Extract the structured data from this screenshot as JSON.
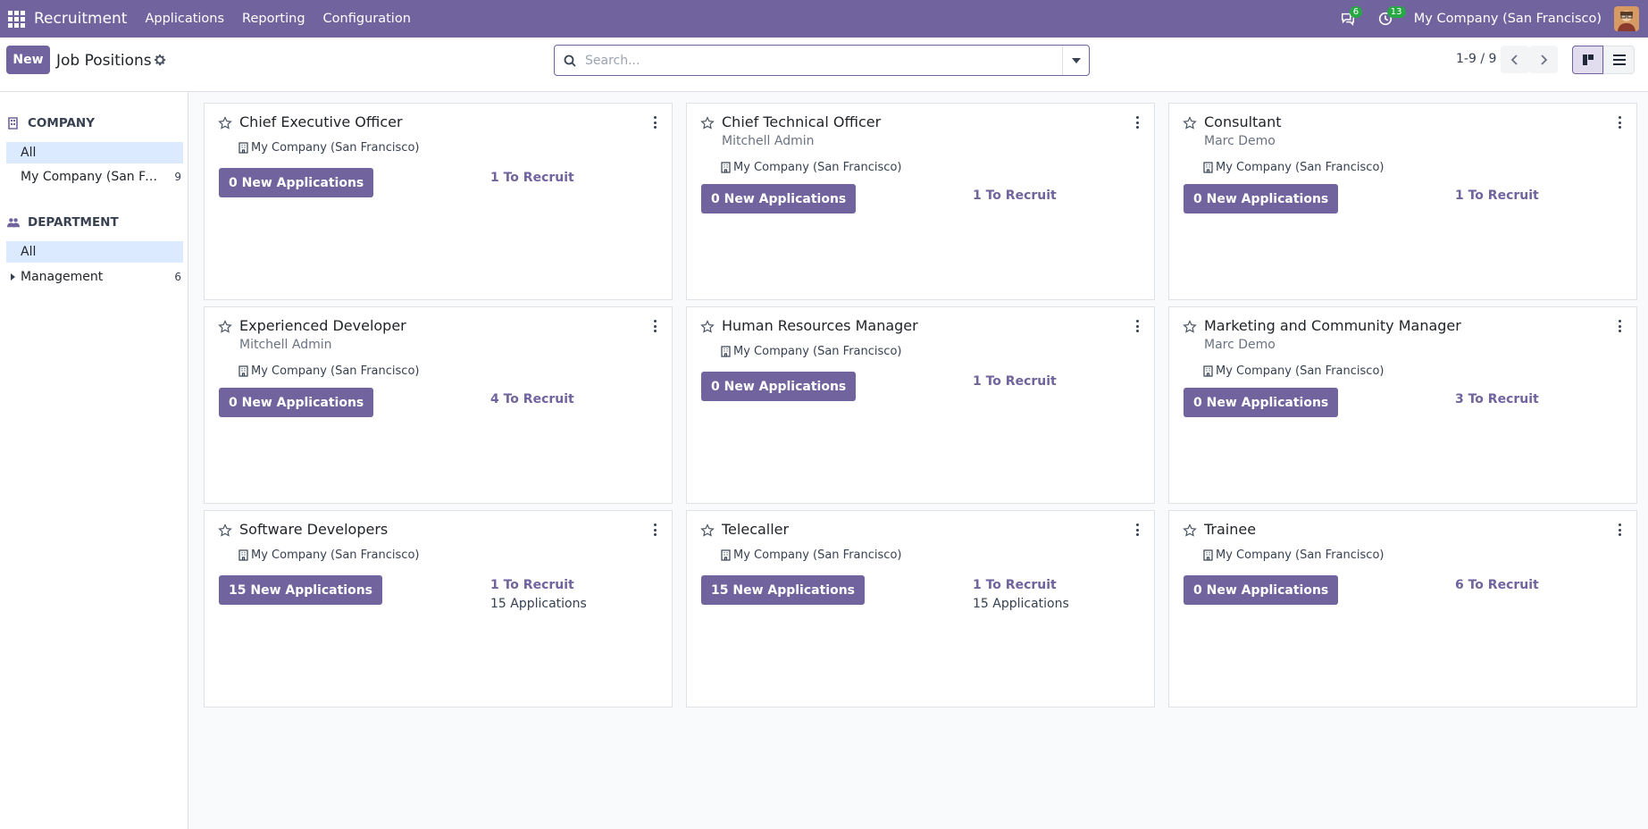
{
  "navbar": {
    "brand": "Recruitment",
    "menu": [
      "Applications",
      "Reporting",
      "Configuration"
    ],
    "messages_count": "6",
    "activities_count": "13",
    "company": "My Company (San Francisco)"
  },
  "control_panel": {
    "new_label": "New",
    "breadcrumb": "Job Positions",
    "search_placeholder": "Search...",
    "pager": "1-9 / 9"
  },
  "sidebar": {
    "company_header": "COMPANY",
    "company_items": [
      {
        "label": "All",
        "count": ""
      },
      {
        "label": "My Company (San Francisco)",
        "count": "9"
      }
    ],
    "department_header": "DEPARTMENT",
    "department_items": [
      {
        "label": "All",
        "count": ""
      },
      {
        "label": "Management",
        "count": "6"
      }
    ]
  },
  "jobs": [
    {
      "title": "Chief Executive Officer",
      "user": "",
      "company": "My Company (San Francisco)",
      "new_apps": "0 New Applications",
      "to_recruit": "1 To Recruit",
      "applications": ""
    },
    {
      "title": "Chief Technical Officer",
      "user": "Mitchell Admin",
      "company": "My Company (San Francisco)",
      "new_apps": "0 New Applications",
      "to_recruit": "1 To Recruit",
      "applications": ""
    },
    {
      "title": "Consultant",
      "user": "Marc Demo",
      "company": "My Company (San Francisco)",
      "new_apps": "0 New Applications",
      "to_recruit": "1 To Recruit",
      "applications": ""
    },
    {
      "title": "Experienced Developer",
      "user": "Mitchell Admin",
      "company": "My Company (San Francisco)",
      "new_apps": "0 New Applications",
      "to_recruit": "4 To Recruit",
      "applications": ""
    },
    {
      "title": "Human Resources Manager",
      "user": "",
      "company": "My Company (San Francisco)",
      "new_apps": "0 New Applications",
      "to_recruit": "1 To Recruit",
      "applications": ""
    },
    {
      "title": "Marketing and Community Manager",
      "user": "Marc Demo",
      "company": "My Company (San Francisco)",
      "new_apps": "0 New Applications",
      "to_recruit": "3 To Recruit",
      "applications": ""
    },
    {
      "title": "Software Developers",
      "user": "",
      "company": "My Company (San Francisco)",
      "new_apps": "15 New Applications",
      "to_recruit": "1 To Recruit",
      "applications": "15 Applications"
    },
    {
      "title": "Telecaller",
      "user": "",
      "company": "My Company (San Francisco)",
      "new_apps": "15 New Applications",
      "to_recruit": "1 To Recruit",
      "applications": "15 Applications"
    },
    {
      "title": "Trainee",
      "user": "",
      "company": "My Company (San Francisco)",
      "new_apps": "0 New Applications",
      "to_recruit": "6 To Recruit",
      "applications": ""
    }
  ]
}
